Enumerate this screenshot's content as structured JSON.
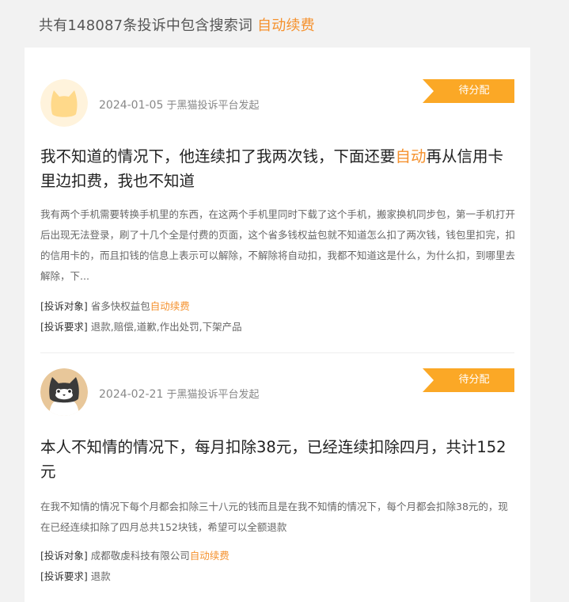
{
  "header": {
    "prefix": "共有148087条投诉中包含搜索词",
    "keyword": "自动续费"
  },
  "complaints": [
    {
      "avatar": "cat-avatar-yellow",
      "date": "2024-01-05",
      "source": "于黑猫投诉平台发起",
      "status": "待分配",
      "title_before": "我不知道的情况下，他连续扣了我两次钱，下面还要",
      "title_keyword": "自动",
      "title_after": "再从信用卡里边扣费，我也不知道",
      "description": "我有两个手机需要转换手机里的东西，在这两个手机里同时下载了这个手机，搬家换机同步包，第一手机打开后出现无法登录，刷了十几个全是付费的页面，这个省多钱权益包就不知道怎么扣了两次钱，钱包里扣完，扣的信用卡的，而且扣钱的信息上表示可以解除，不解除将自动扣，我都不知道这是什么，为什么扣，到哪里去解除，下...",
      "target_label": "[投诉对象]",
      "target_value": "省多快权益包",
      "target_keyword": "自动续费",
      "demand_label": "[投诉要求]",
      "demand_value": "退款,赔偿,道歉,作出处罚,下架产品"
    },
    {
      "avatar": "cat-avatar-black",
      "date": "2024-02-21",
      "source": "于黑猫投诉平台发起",
      "status": "待分配",
      "title_before": "本人不知情的情况下，每月扣除38元，已经连续扣除四月，共计152元",
      "title_keyword": "",
      "title_after": "",
      "description": "在我不知情的情况下每个月都会扣除三十八元的钱而且是在我不知情的情况下，每个月都会扣除38元的，现在已经连续扣除了四月总共152块钱，希望可以全额退款",
      "target_label": "[投诉对象]",
      "target_value": "成都敬虔科技有限公司",
      "target_keyword": "自动续费",
      "demand_label": "[投诉要求]",
      "demand_value": "退款"
    }
  ]
}
